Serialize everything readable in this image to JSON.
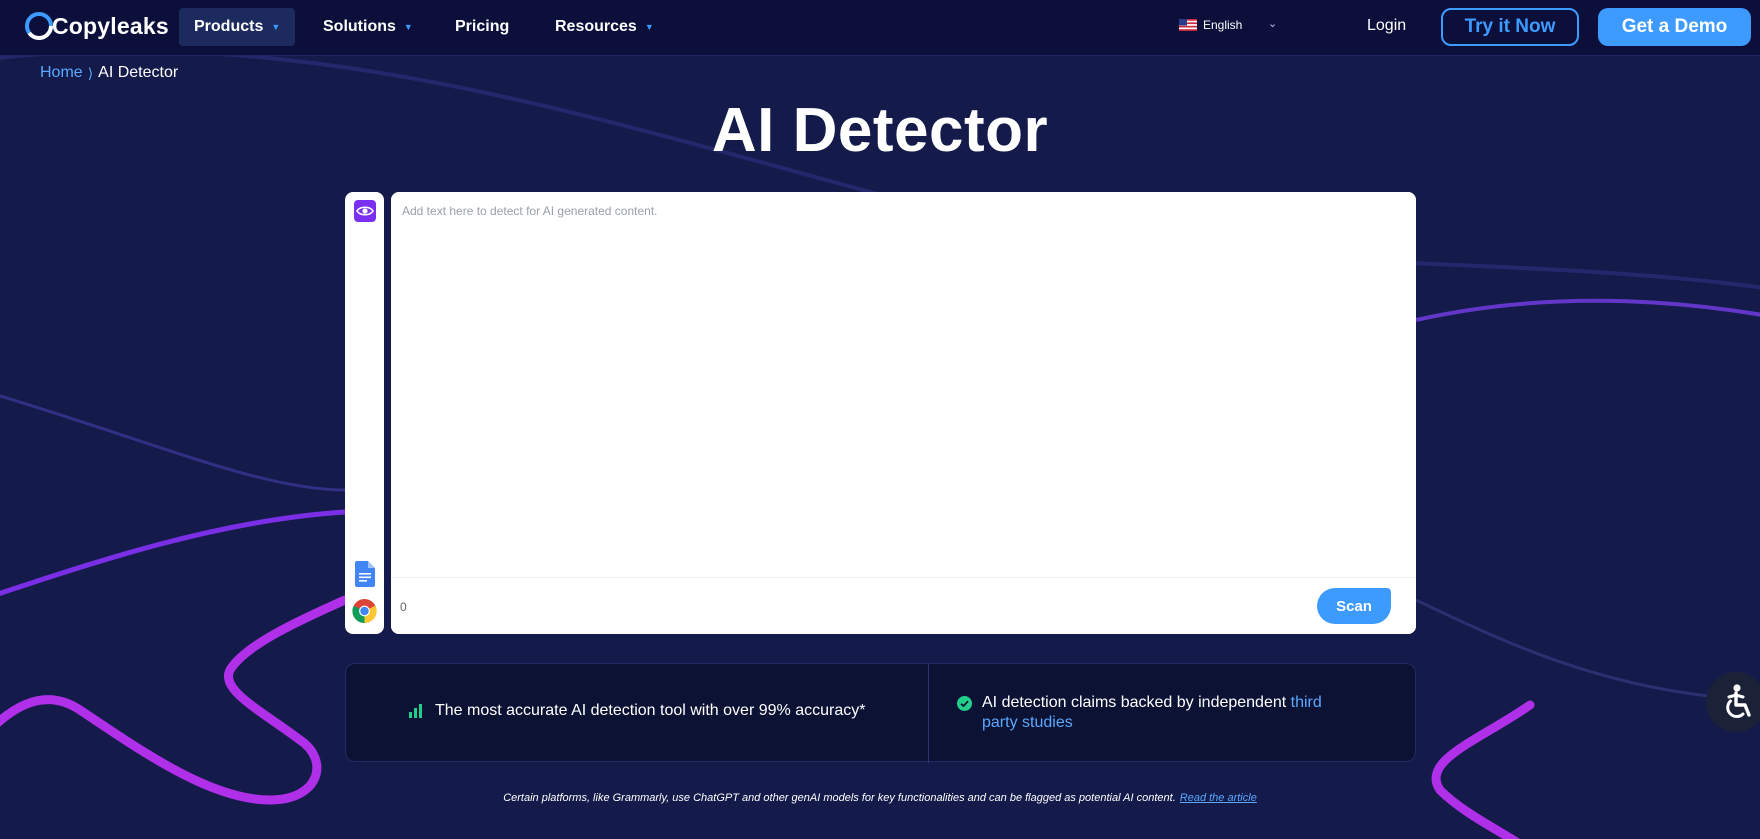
{
  "brand": {
    "name": "Copyleaks"
  },
  "nav": {
    "items": [
      {
        "label": "Products",
        "has_caret": true,
        "active": true
      },
      {
        "label": "Solutions",
        "has_caret": true
      },
      {
        "label": "Pricing",
        "has_caret": false
      },
      {
        "label": "Resources",
        "has_caret": true
      }
    ],
    "caret_glyph": "▼",
    "language": "English",
    "language_caret": "⌄",
    "login": "Login",
    "try_now": "Try it Now",
    "get_demo": "Get a Demo"
  },
  "breadcrumb": {
    "home": "Home",
    "separator": "⟩",
    "current": "AI Detector"
  },
  "page_title": "AI Detector",
  "side_rail": {
    "icons": [
      "eye-icon",
      "google-docs-icon",
      "chrome-icon"
    ]
  },
  "editor": {
    "placeholder": "Add text here to detect for AI generated content.",
    "value": "",
    "word_count": "0",
    "scan_label": "Scan"
  },
  "claims": {
    "first": {
      "icon": "bar-chart-icon",
      "text": "The most accurate AI detection tool with over 99% accuracy*"
    },
    "second": {
      "icon": "check-circle-icon",
      "text": "AI detection claims backed by independent",
      "link": "third party studies"
    }
  },
  "disclaimer": {
    "text": "Certain platforms, like Grammarly, use ChatGPT and other genAI models for key functionalities and can be flagged as potential AI content.",
    "link": "Read the article"
  },
  "accessibility": {
    "icon": "accessibility-icon"
  },
  "colors": {
    "background": "#141a4a",
    "topbar": "#0b0f3a",
    "accent_blue": "#3d9bff",
    "purple": "#8a2be2",
    "success_green": "#1fcf8a"
  }
}
